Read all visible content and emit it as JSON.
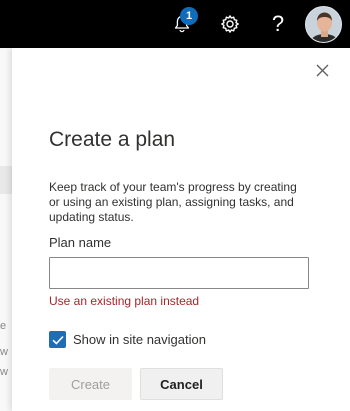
{
  "topbar": {
    "notification_count": "1",
    "help_label": "?"
  },
  "background": {
    "fragments": [
      "e",
      "w",
      "w"
    ]
  },
  "panel": {
    "title": "Create a plan",
    "description": "Keep track of your team's progress by creating or using an existing plan, assigning tasks, and updating status.",
    "plan_name_label": "Plan name",
    "plan_name_value": "",
    "existing_plan_link": "Use an existing plan instead",
    "show_in_nav_label": "Show in site navigation",
    "show_in_nav_checked": true,
    "create_label": "Create",
    "cancel_label": "Cancel"
  },
  "colors": {
    "topbar_bg": "#000000",
    "badge": "#0f6cbd",
    "checkbox": "#1f6db5",
    "error_text": "#a4262c"
  }
}
